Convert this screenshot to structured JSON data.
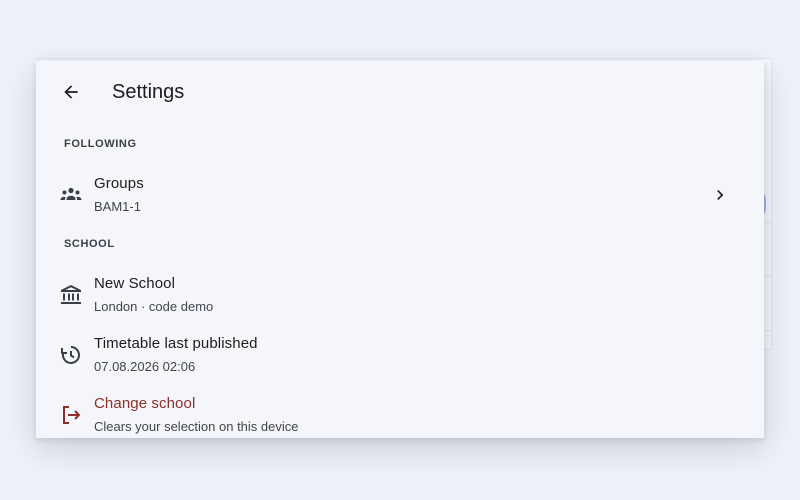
{
  "header": {
    "title": "Settings",
    "back_icon": "arrow-back-icon"
  },
  "sections": {
    "following": {
      "header": "FOLLOWING",
      "groups": {
        "title": "Groups",
        "subtitle": "BAM1-1",
        "icon": "groups-icon",
        "trailing_icon": "chevron-right-icon"
      }
    },
    "school": {
      "header": "SCHOOL",
      "school": {
        "title": "New School",
        "subtitle": "London · code demo",
        "icon": "institution-icon"
      },
      "timetable": {
        "title": "Timetable last published",
        "subtitle": "07.08.2026 02:06",
        "icon": "history-clock-icon"
      },
      "change": {
        "title": "Change school",
        "subtitle": "Clears your selection on this device",
        "icon": "logout-icon",
        "color": "#8c2f2a"
      }
    }
  },
  "colors": {
    "background": "#eef1f7",
    "surface": "#f5f6fb",
    "text": "#1b1c20",
    "danger": "#8c2f2a"
  }
}
